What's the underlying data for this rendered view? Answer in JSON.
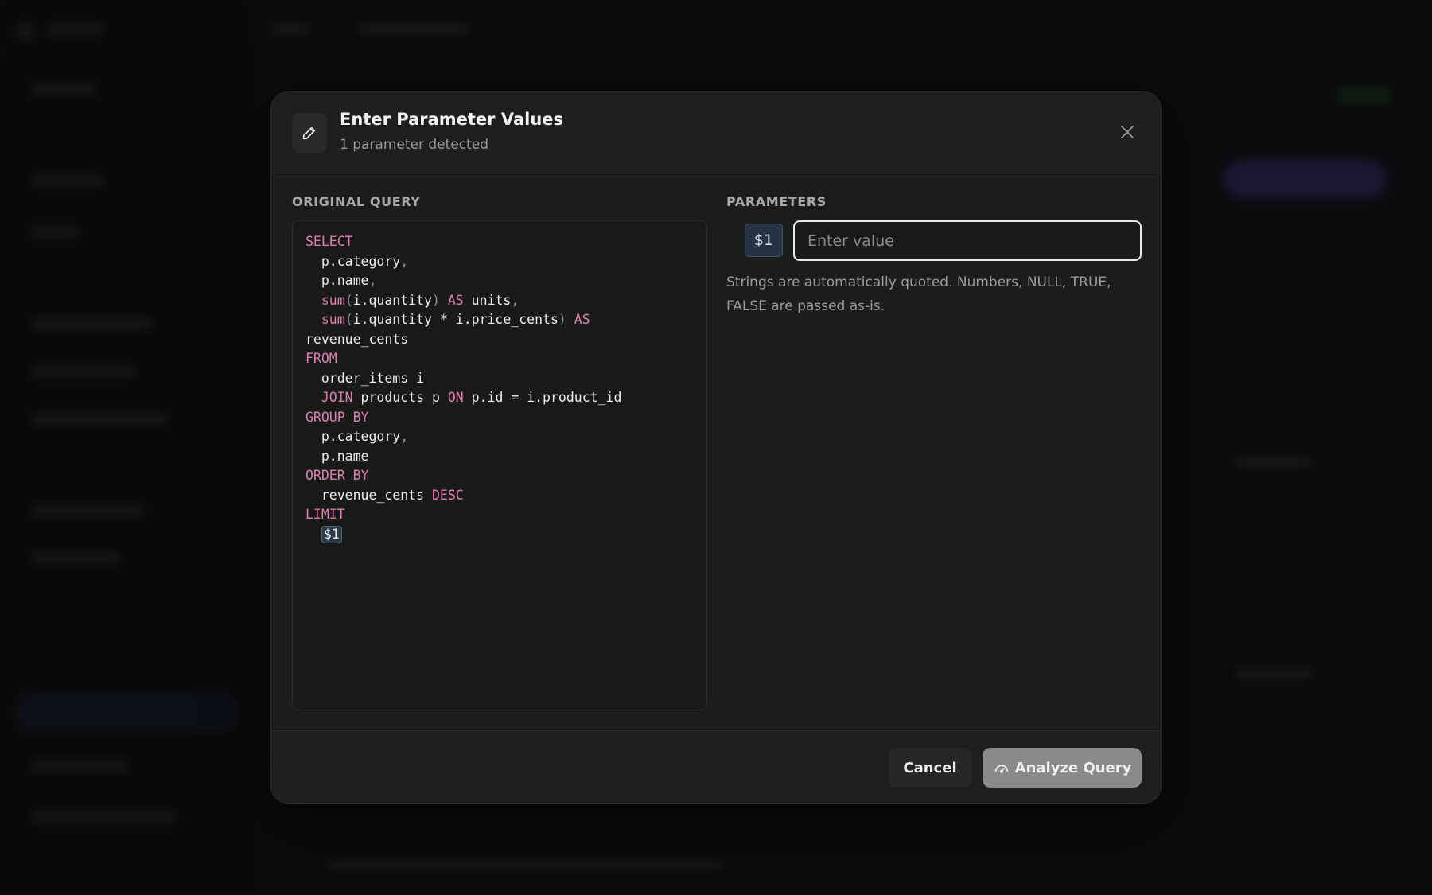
{
  "dialog": {
    "title": "Enter Parameter Values",
    "subtitle": "1 parameter detected",
    "close_icon": "close-icon",
    "header_icon": "pencil-icon"
  },
  "original_query": {
    "label": "ORIGINAL QUERY",
    "lines": [
      [
        [
          "kw",
          "SELECT"
        ]
      ],
      [
        [
          "tx",
          "  p.category"
        ],
        [
          "pn",
          ","
        ]
      ],
      [
        [
          "tx",
          "  p.name"
        ],
        [
          "pn",
          ","
        ]
      ],
      [
        [
          "tx",
          "  "
        ],
        [
          "kw",
          "sum"
        ],
        [
          "pn",
          "("
        ],
        [
          "tx",
          "i.quantity"
        ],
        [
          "pn",
          ")"
        ],
        [
          "tx",
          " "
        ],
        [
          "kw",
          "AS"
        ],
        [
          "tx",
          " units"
        ],
        [
          "pn",
          ","
        ]
      ],
      [
        [
          "tx",
          "  "
        ],
        [
          "kw",
          "sum"
        ],
        [
          "pn",
          "("
        ],
        [
          "tx",
          "i.quantity * i.price_cents"
        ],
        [
          "pn",
          ")"
        ],
        [
          "tx",
          " "
        ],
        [
          "kw",
          "AS"
        ]
      ],
      [
        [
          "tx",
          "revenue_cents"
        ]
      ],
      [
        [
          "kw",
          "FROM"
        ]
      ],
      [
        [
          "tx",
          "  order_items i"
        ]
      ],
      [
        [
          "tx",
          "  "
        ],
        [
          "kw",
          "JOIN"
        ],
        [
          "tx",
          " products p "
        ],
        [
          "kw",
          "ON"
        ],
        [
          "tx",
          " p.id = i.product_id"
        ]
      ],
      [
        [
          "kw",
          "GROUP BY"
        ]
      ],
      [
        [
          "tx",
          "  p.category"
        ],
        [
          "pn",
          ","
        ]
      ],
      [
        [
          "tx",
          "  p.name"
        ]
      ],
      [
        [
          "kw",
          "ORDER BY"
        ]
      ],
      [
        [
          "tx",
          "  revenue_cents "
        ],
        [
          "kw",
          "DESC"
        ]
      ],
      [
        [
          "kw",
          "LIMIT"
        ]
      ],
      [
        [
          "tx",
          "  "
        ],
        [
          "param",
          "$1"
        ]
      ]
    ]
  },
  "parameters": {
    "label": "PARAMETERS",
    "items": [
      {
        "name": "$1",
        "value": "",
        "placeholder": "Enter value"
      }
    ],
    "help_text": "Strings are automatically quoted. Numbers, NULL, TRUE, FALSE are passed as-is."
  },
  "footer": {
    "cancel_label": "Cancel",
    "analyze_label": "Analyze Query",
    "analyze_icon": "gauge-icon"
  },
  "colors": {
    "keyword": "#e07cb4",
    "modal_bg": "#1c1c1b",
    "param_badge_bg": "#243444",
    "analyze_button_bg": "#8a8a88"
  }
}
